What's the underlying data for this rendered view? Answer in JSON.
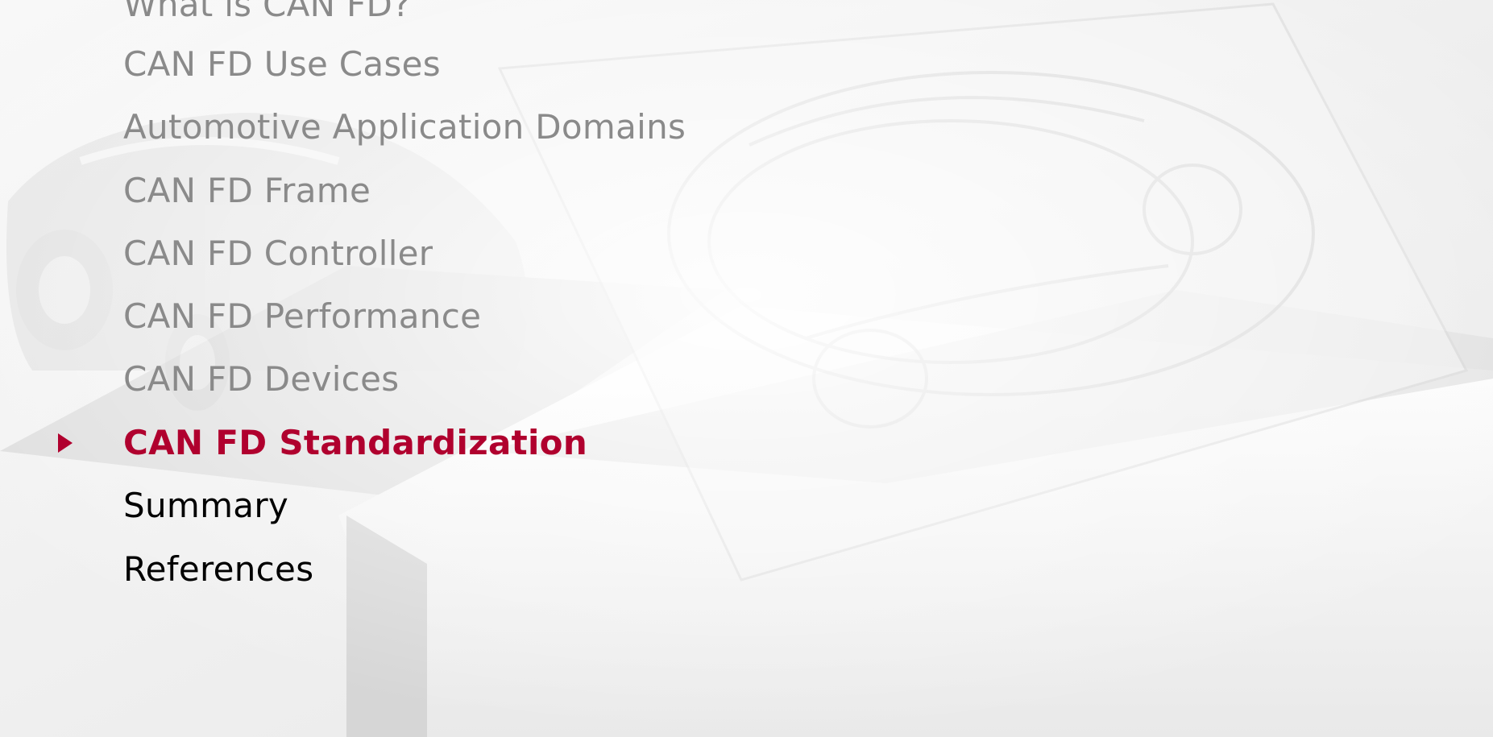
{
  "agenda": {
    "items": [
      {
        "label": "What is CAN FD?",
        "state": "done"
      },
      {
        "label": "CAN FD Use Cases",
        "state": "done"
      },
      {
        "label": "Automotive Application Domains",
        "state": "done"
      },
      {
        "label": "CAN FD Frame",
        "state": "done"
      },
      {
        "label": "CAN FD Controller",
        "state": "done"
      },
      {
        "label": "CAN FD Performance",
        "state": "done"
      },
      {
        "label": "CAN FD Devices",
        "state": "done"
      },
      {
        "label": "CAN FD Standardization",
        "state": "current"
      },
      {
        "label": "Summary",
        "state": "upcoming"
      },
      {
        "label": "References",
        "state": "upcoming"
      }
    ]
  },
  "colors": {
    "current": "#b0002e",
    "done": "#8a8a8a",
    "upcoming": "#000000"
  },
  "icons": {
    "current_marker": "triangle-right-icon"
  }
}
